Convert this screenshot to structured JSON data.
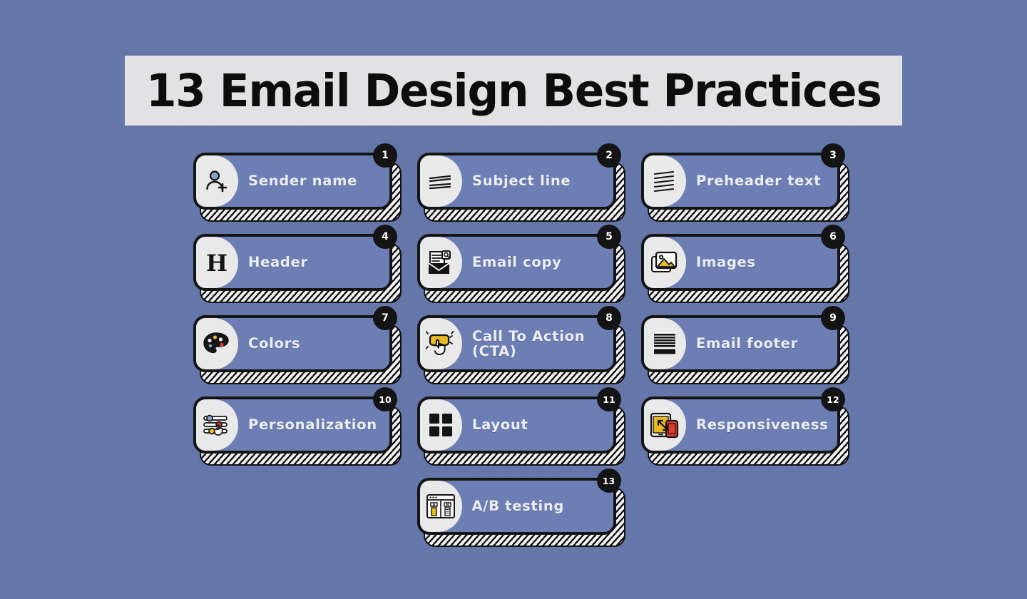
{
  "page": {
    "title": "13 Email Design Best Practices",
    "background_color": "#6577aa",
    "banner_color": "#e2e2e4",
    "card_fill": "#6c7eb4",
    "card_border": "#141414",
    "icon_tile_fill": "#e9e9e9",
    "label_color": "#eceef4",
    "badge_color": "#141414"
  },
  "cards": [
    {
      "number": "1",
      "label": "Sender name",
      "label_line2": "",
      "icon": "person-add-icon"
    },
    {
      "number": "2",
      "label": "Subject line",
      "label_line2": "",
      "icon": "two-lines-icon"
    },
    {
      "number": "3",
      "label": "Preheader text",
      "label_line2": "",
      "icon": "three-lines-icon"
    },
    {
      "number": "4",
      "label": "Header",
      "label_line2": "",
      "icon": "letter-h-icon"
    },
    {
      "number": "5",
      "label": "Email copy",
      "label_line2": "",
      "icon": "envelope-document-icon"
    },
    {
      "number": "6",
      "label": "Images",
      "label_line2": "",
      "icon": "photo-icon"
    },
    {
      "number": "7",
      "label": "Colors",
      "label_line2": "",
      "icon": "paint-palette-icon"
    },
    {
      "number": "8",
      "label": "Call To Action",
      "label_line2": "(CTA)",
      "icon": "click-button-icon"
    },
    {
      "number": "9",
      "label": "Email footer",
      "label_line2": "",
      "icon": "footer-block-icon"
    },
    {
      "number": "10",
      "label": "Personalization",
      "label_line2": "",
      "icon": "sliders-icon"
    },
    {
      "number": "11",
      "label": "Layout",
      "label_line2": "",
      "icon": "grid-four-squares-icon"
    },
    {
      "number": "12",
      "label": "Responsiveness",
      "label_line2": "",
      "icon": "tablet-phone-icon"
    },
    {
      "number": "13",
      "label": "A/B testing",
      "label_line2": "",
      "icon": "ab-test-browser-icon"
    }
  ],
  "rows": [
    [
      0,
      1,
      2
    ],
    [
      3,
      4,
      5
    ],
    [
      6,
      7,
      8
    ],
    [
      9,
      10,
      11
    ],
    [
      12
    ]
  ]
}
